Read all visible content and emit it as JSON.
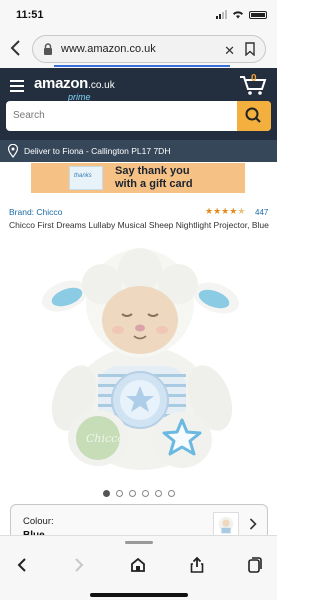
{
  "status_bar": {
    "time": "11:51"
  },
  "browser": {
    "url": "www.amazon.co.uk"
  },
  "header": {
    "logo_text": "amazon",
    "logo_tld": ".co.uk",
    "logo_sub": "prime",
    "cart_count": "0",
    "search_placeholder": "Search",
    "accent": "#f3b03f",
    "background": "#232f3e"
  },
  "delivery": {
    "text": "Deliver to Fiona - Callington PL17 7DH"
  },
  "banner": {
    "card_text": "thanks",
    "line1": "Say thank you",
    "line2": "with a gift card"
  },
  "product": {
    "brand": "Brand: Chicco",
    "rating_stars": 4.5,
    "rating_count": "447",
    "title": "Chicco First Dreams Lullaby Musical Sheep Nightlight Projector, Blue",
    "image_badge_text": "Chicco",
    "image_count": 6,
    "image_index": 1
  },
  "options": {
    "colour_label": "Colour:",
    "colour_value": "Blue"
  },
  "toolbar": {
    "icons": [
      "back-icon",
      "forward-icon",
      "home-icon",
      "share-icon",
      "tabs-icon"
    ]
  }
}
